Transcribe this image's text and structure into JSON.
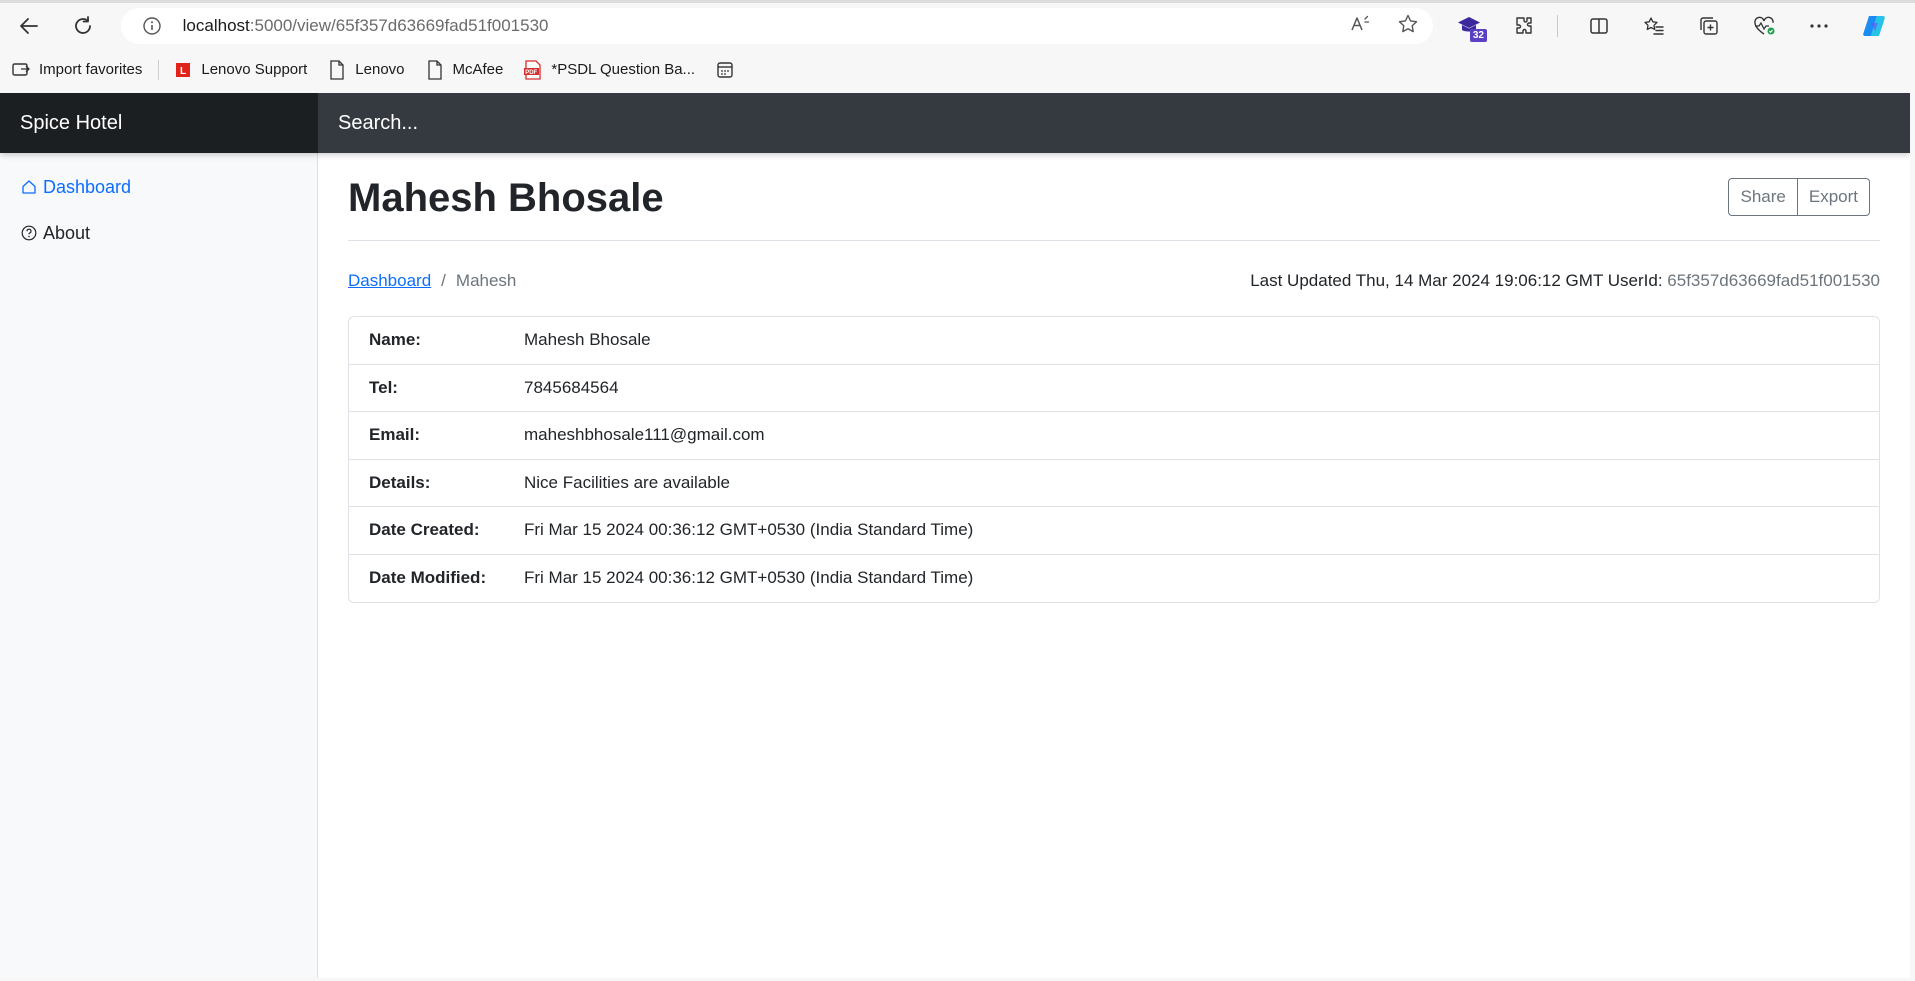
{
  "browser": {
    "url_host": "localhost",
    "url_path": ":5000/view/65f357d63669fad51f001530",
    "extension_badge": "32",
    "favorites": [
      {
        "label": "Import favorites"
      },
      {
        "label": "Lenovo Support"
      },
      {
        "label": "Lenovo"
      },
      {
        "label": "McAfee"
      },
      {
        "label": "*PSDL Question Ba..."
      }
    ]
  },
  "app": {
    "brand": "Spice Hotel",
    "search_placeholder": "Search..."
  },
  "sidebar": {
    "items": [
      {
        "label": "Dashboard",
        "icon": "home-icon"
      },
      {
        "label": "About",
        "icon": "question-circle-icon"
      }
    ]
  },
  "page": {
    "title": "Mahesh Bhosale",
    "share_label": "Share",
    "export_label": "Export",
    "breadcrumb_root": "Dashboard",
    "breadcrumb_sep": "/",
    "breadcrumb_current": "Mahesh",
    "updated_label": "Last Updated Thu, 14 Mar 2024 19:06:12 GMT UserId:",
    "user_id": "65f357d63669fad51f001530"
  },
  "details": [
    {
      "key": "Name:",
      "value": "Mahesh Bhosale"
    },
    {
      "key": "Tel:",
      "value": "7845684564"
    },
    {
      "key": "Email:",
      "value": "maheshbhosale111@gmail.com"
    },
    {
      "key": "Details:",
      "value": "Nice Facilities are available"
    },
    {
      "key": "Date Created:",
      "value": "Fri Mar 15 2024 00:36:12 GMT+0530 (India Standard Time)"
    },
    {
      "key": "Date Modified:",
      "value": "Fri Mar 15 2024 00:36:12 GMT+0530 (India Standard Time)"
    }
  ],
  "colors": {
    "accent": "#0d6efd",
    "navbar": "#343a40",
    "brand_bg": "#1c1f22"
  }
}
